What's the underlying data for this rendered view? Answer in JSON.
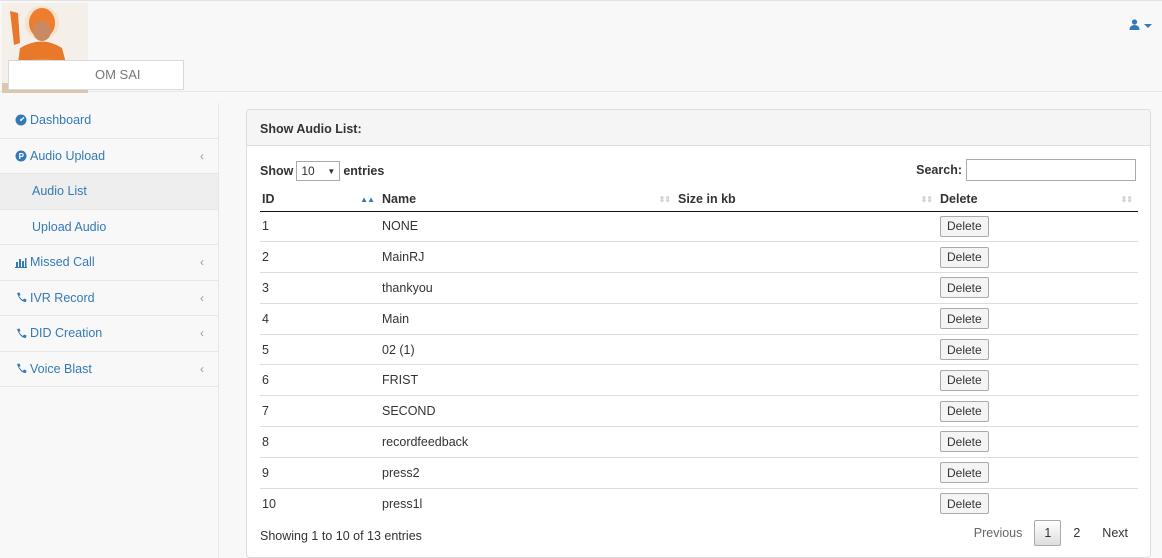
{
  "brand": {
    "name": "OM SAI"
  },
  "header": {
    "user_icon": "user-icon"
  },
  "sidebar": {
    "items": [
      {
        "label": "Dashboard",
        "icon": "dashboard-icon"
      },
      {
        "label": "Audio Upload",
        "icon": "audio-upload-icon"
      },
      {
        "label": "Audio List"
      },
      {
        "label": "Upload Audio"
      },
      {
        "label": "Missed Call",
        "icon": "bar-chart-icon"
      },
      {
        "label": "IVR Record",
        "icon": "phone-icon"
      },
      {
        "label": "DID Creation",
        "icon": "phone-icon"
      },
      {
        "label": "Voice Blast",
        "icon": "phone-icon"
      }
    ]
  },
  "panel": {
    "title": "Show Audio List:"
  },
  "controls": {
    "show_label": "Show",
    "entries_value": "10",
    "entries_label": "entries",
    "search_label": "Search:",
    "search_value": ""
  },
  "table": {
    "columns": [
      "ID",
      "Name",
      "Size in kb",
      "Delete"
    ],
    "rows": [
      {
        "id": "1",
        "name": "NONE",
        "size": "",
        "action": "Delete"
      },
      {
        "id": "2",
        "name": "MainRJ",
        "size": "",
        "action": "Delete"
      },
      {
        "id": "3",
        "name": "thankyou",
        "size": "",
        "action": "Delete"
      },
      {
        "id": "4",
        "name": "Main",
        "size": "",
        "action": "Delete"
      },
      {
        "id": "5",
        "name": "02 (1)",
        "size": "",
        "action": "Delete"
      },
      {
        "id": "6",
        "name": "FRIST",
        "size": "",
        "action": "Delete"
      },
      {
        "id": "7",
        "name": "SECOND",
        "size": "",
        "action": "Delete"
      },
      {
        "id": "8",
        "name": "recordfeedback",
        "size": "",
        "action": "Delete"
      },
      {
        "id": "9",
        "name": "press2",
        "size": "",
        "action": "Delete"
      },
      {
        "id": "10",
        "name": "press1l",
        "size": "",
        "action": "Delete"
      }
    ]
  },
  "footer": {
    "info": "Showing 1 to 10 of 13 entries",
    "previous": "Previous",
    "pages": [
      "1",
      "2"
    ],
    "next": "Next"
  },
  "colors": {
    "link": "#337ab7",
    "logo_robe": "#e8782a"
  }
}
